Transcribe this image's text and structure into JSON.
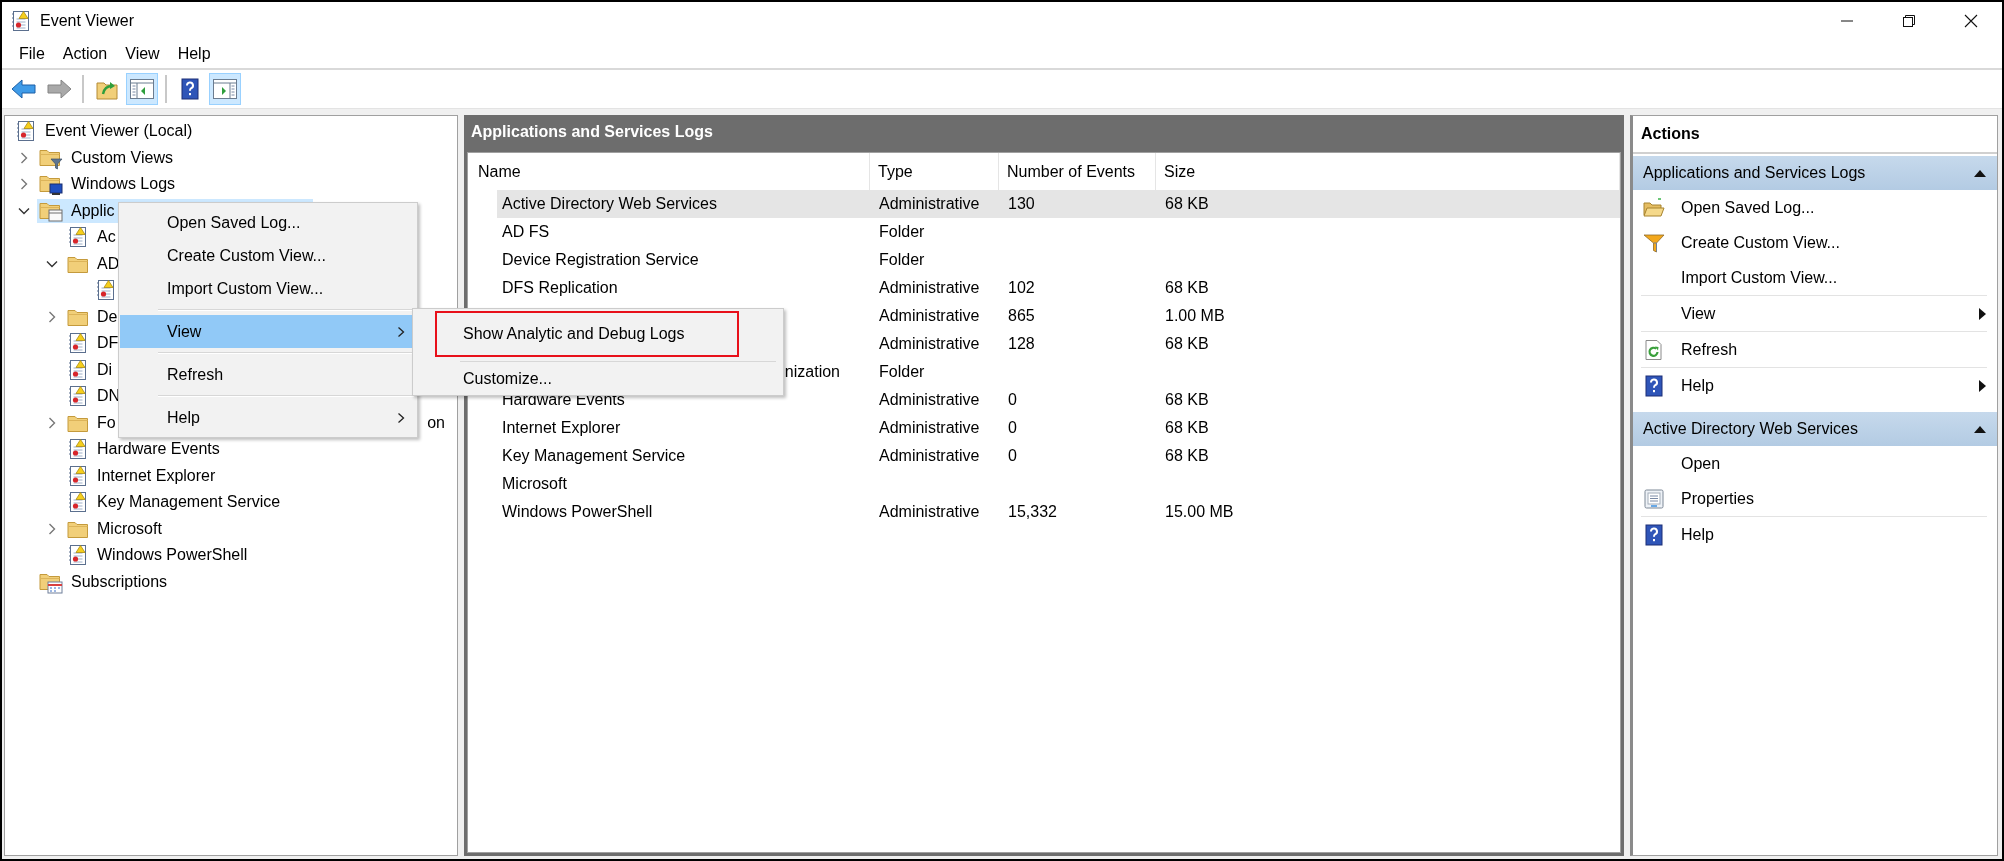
{
  "window": {
    "title": "Event Viewer"
  },
  "menu_bar": [
    "File",
    "Action",
    "View",
    "Help"
  ],
  "toolbar": [
    {
      "kind": "back",
      "pressed": false,
      "disabled": false
    },
    {
      "kind": "forward",
      "pressed": false,
      "disabled": true
    },
    {
      "kind": "separator"
    },
    {
      "kind": "up",
      "pressed": false,
      "disabled": false
    },
    {
      "kind": "console-tree",
      "pressed": true,
      "disabled": false
    },
    {
      "kind": "separator"
    },
    {
      "kind": "help",
      "pressed": false,
      "disabled": false
    },
    {
      "kind": "action-pane",
      "pressed": true,
      "disabled": false
    }
  ],
  "tree": {
    "items": [
      {
        "label": "Event Viewer (Local)",
        "kind": "root",
        "selected": false,
        "children": [
          {
            "label": "Custom Views",
            "kind": "custom-views",
            "expanded": false,
            "selected": false
          },
          {
            "label": "Windows Logs",
            "kind": "windows-logs",
            "expanded": false,
            "selected": false
          },
          {
            "label": "Applic",
            "kind": "app-logs",
            "expanded": true,
            "selected": true,
            "children": [
              {
                "label": "Ac",
                "kind": "log",
                "selected": false
              },
              {
                "label": "AD",
                "kind": "folder",
                "expanded": true,
                "selected": false,
                "children": [
                  {
                    "kind": "log",
                    "selected": false
                  }
                ]
              },
              {
                "label": "De",
                "kind": "folder",
                "expanded": false,
                "selected": false
              },
              {
                "label": "DF",
                "kind": "log",
                "selected": false
              },
              {
                "label": "Di",
                "kind": "log",
                "selected": false
              },
              {
                "label": "DN",
                "kind": "log",
                "selected": false
              },
              {
                "label": "Fo",
                "label_end": "on",
                "kind": "folder",
                "expanded": false,
                "selected": false
              },
              {
                "label": "Hardware Events",
                "kind": "log",
                "selected": false
              },
              {
                "label": "Internet Explorer",
                "kind": "log",
                "selected": false
              },
              {
                "label": "Key Management Service",
                "kind": "log",
                "selected": false
              },
              {
                "label": "Microsoft",
                "kind": "folder",
                "expanded": false,
                "selected": false
              },
              {
                "label": "Windows PowerShell",
                "kind": "log",
                "selected": false
              }
            ]
          },
          {
            "label": "Subscriptions",
            "kind": "subscriptions",
            "selected": false
          }
        ]
      }
    ]
  },
  "content": {
    "title": "Applications and Services Logs",
    "columns": [
      "Name",
      "Type",
      "Number of Events",
      "Size"
    ],
    "rows": [
      {
        "name": "Active Directory Web Services",
        "type": "Administrative",
        "events": "130",
        "size": "68 KB",
        "selected": true
      },
      {
        "name": "AD FS",
        "type": "Folder",
        "selected": false
      },
      {
        "name": "Device Registration Service",
        "type": "Folder",
        "selected": false
      },
      {
        "name": "DFS Replication",
        "type": "Administrative",
        "events": "102",
        "size": "68 KB",
        "selected": false
      },
      {
        "type": "Administrative",
        "events": "865",
        "size": "1.00 MB",
        "selected": false
      },
      {
        "type": "Administrative",
        "events": "128",
        "size": "68 KB",
        "selected": false
      },
      {
        "name_end": "nization",
        "type": "Folder",
        "selected": false
      },
      {
        "name": "Hardware Events",
        "type": "Administrative",
        "events": "0",
        "size": "68 KB",
        "selected": false
      },
      {
        "name": "Internet Explorer",
        "type": "Administrative",
        "events": "0",
        "size": "68 KB",
        "selected": false
      },
      {
        "name": "Key Management Service",
        "type": "Administrative",
        "events": "0",
        "size": "68 KB",
        "selected": false
      },
      {
        "name": "Microsoft",
        "selected": false
      },
      {
        "name": "Windows PowerShell",
        "type": "Administrative",
        "events": "15,332",
        "size": "15.00 MB",
        "selected": false
      }
    ]
  },
  "actions": {
    "title": "Actions",
    "sections": [
      {
        "title": "Applications and Services Logs",
        "expanded": true,
        "items": [
          {
            "kind": "item",
            "label": "Open Saved Log..."
          },
          {
            "kind": "item",
            "label": "Create Custom View..."
          },
          {
            "kind": "item",
            "label": "Import Custom View..."
          },
          {
            "kind": "separator"
          },
          {
            "kind": "submenu",
            "label": "View"
          },
          {
            "kind": "separator"
          },
          {
            "kind": "item",
            "label": "Refresh"
          },
          {
            "kind": "separator"
          },
          {
            "kind": "submenu",
            "label": "Help"
          }
        ]
      },
      {
        "title": "Active Directory Web Services",
        "expanded": true,
        "items": [
          {
            "kind": "item",
            "label": "Open"
          },
          {
            "kind": "item",
            "label": "Properties"
          },
          {
            "kind": "separator"
          },
          {
            "kind": "item",
            "label": "Help"
          }
        ]
      }
    ]
  },
  "context_menu": {
    "items": [
      {
        "kind": "item",
        "label": "Open Saved Log...",
        "selected": false
      },
      {
        "kind": "item",
        "label": "Create Custom View...",
        "selected": false
      },
      {
        "kind": "item",
        "label": "Import Custom View...",
        "selected": false
      },
      {
        "kind": "separator"
      },
      {
        "kind": "submenu",
        "label": "View",
        "selected": true
      },
      {
        "kind": "separator"
      },
      {
        "kind": "item",
        "label": "Refresh",
        "selected": false
      },
      {
        "kind": "separator"
      },
      {
        "kind": "submenu",
        "label": "Help",
        "selected": false
      }
    ]
  },
  "submenu": {
    "items": [
      {
        "kind": "item",
        "label": "Show Analytic and Debug Logs",
        "annotated": true
      },
      {
        "kind": "separator"
      },
      {
        "kind": "item",
        "label": "Customize...",
        "annotated": false
      }
    ]
  }
}
